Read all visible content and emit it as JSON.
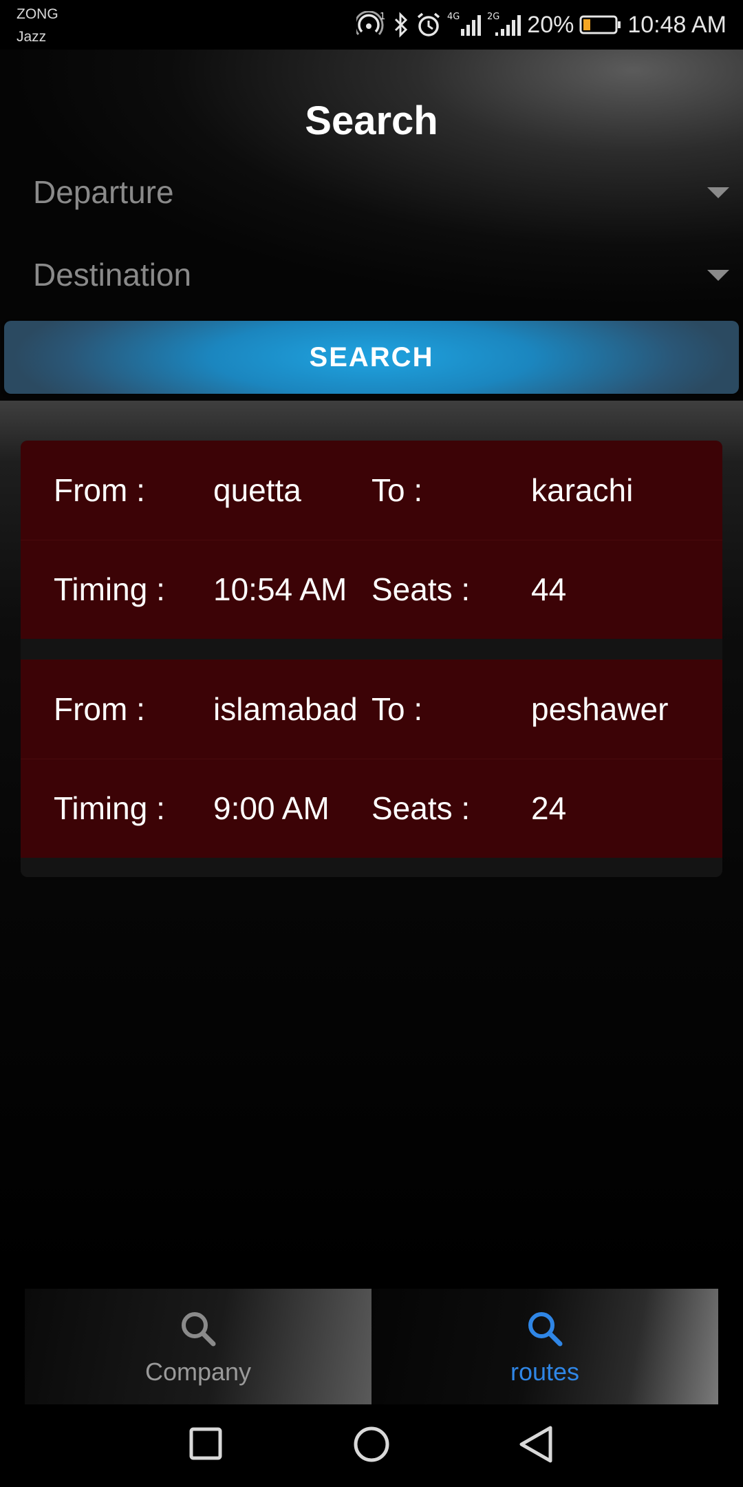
{
  "status_bar": {
    "carrier_1": "ZONG",
    "carrier_2": "Jazz",
    "network_1": "4G",
    "network_2": "2G",
    "battery": "20%",
    "time": "10:48 AM",
    "icons": [
      "hotspot-icon",
      "bluetooth-icon",
      "alarm-icon",
      "signal-icon",
      "battery-icon"
    ]
  },
  "header": {
    "title": "Search",
    "departure_placeholder": "Departure",
    "destination_placeholder": "Destination",
    "search_label": "SEARCH"
  },
  "routes": [
    {
      "from_label": "From :",
      "from": "quetta",
      "to_label": "To :",
      "to": "karachi",
      "timing_label": "Timing :",
      "timing": "10:54 AM",
      "seats_label": "Seats :",
      "seats": "44"
    },
    {
      "from_label": "From :",
      "from": "islamabad",
      "to_label": "To :",
      "to": "peshawer",
      "timing_label": "Timing :",
      "timing": "9:00 AM",
      "seats_label": "Seats :",
      "seats": "24"
    }
  ],
  "bottom_nav": {
    "tabs": [
      {
        "label": "Company",
        "icon": "search-icon",
        "active": false
      },
      {
        "label": "routes",
        "icon": "search-icon",
        "active": true
      }
    ]
  },
  "colors": {
    "accent": "#2f86e6",
    "card": "#3c0306",
    "button": "#1fa3e0"
  }
}
